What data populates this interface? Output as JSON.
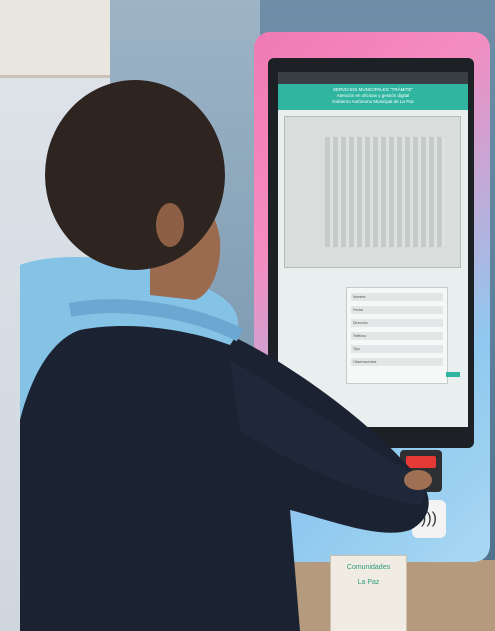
{
  "screen": {
    "banner_title": "SERVICIOS MUNICIPALES \"TRÁMITE\"",
    "banner_line2": "Atención en oficinas y gestión digital",
    "banner_line3": "Gobierno Autónomo Municipal de La Paz",
    "form_fields": [
      "Nombre",
      "Fecha",
      "Dirección",
      "Teléfono",
      "Tipo",
      "Observaciones"
    ]
  },
  "boxes": {
    "label_1": "Comunidades",
    "label_2": "La Paz"
  },
  "colors": {
    "kiosk_pink": "#f07ab3",
    "kiosk_blue": "#8fc8ef",
    "app_teal": "#2fb5a0",
    "jacket_blue": "#84c2e6",
    "jacket_navy": "#1b2333"
  }
}
